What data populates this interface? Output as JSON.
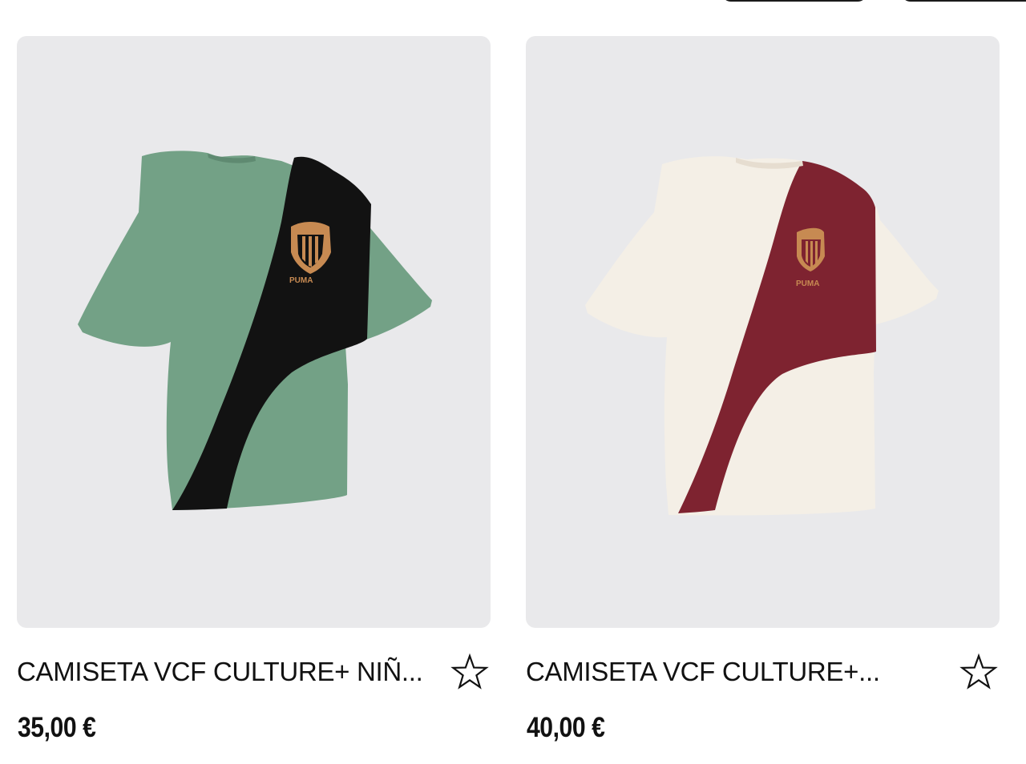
{
  "products": [
    {
      "title": "CAMISETA VCF CULTURE+ NIÑ...",
      "price": "35,00 €",
      "image_icon": "green-black-tshirt-image",
      "colors": {
        "base": "#73a186",
        "stripe": "#121212",
        "logo": "#c78a52"
      },
      "favorite_icon": "star-outline-icon",
      "logo_text": "PUMA"
    },
    {
      "title": "CAMISETA VCF CULTURE+...",
      "price": "40,00 €",
      "image_icon": "cream-burgundy-tshirt-image",
      "colors": {
        "base": "#f4efe6",
        "stripe": "#7e2330",
        "logo": "#c78a52"
      },
      "favorite_icon": "star-outline-icon",
      "logo_text": "PUMA"
    }
  ],
  "filters": [
    {
      "label": ""
    },
    {
      "label": ""
    }
  ],
  "theme": {
    "image_background": "#e9e9eb",
    "text": "#111111"
  }
}
